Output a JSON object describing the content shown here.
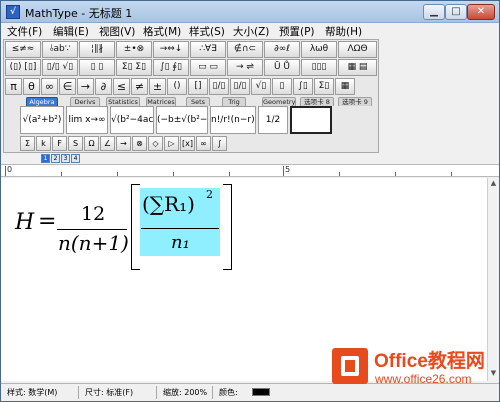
{
  "window": {
    "title": "MathType - 无标题 1"
  },
  "menu": [
    "文件(F)",
    "编辑(E)",
    "视图(V)",
    "格式(M)",
    "样式(S)",
    "大小(Z)",
    "预置(P)",
    "帮助(H)"
  ],
  "palette": {
    "row1": [
      "≤≠≈",
      "⫰ab∵",
      "¦∥∦",
      "±•⊗",
      "→⇔↓",
      "∴∀∃",
      "∉∩⊂",
      "∂∞ℓ",
      "λωθ",
      "ΛΩΘ"
    ],
    "row2": [
      "(▯) [▯]",
      "▯/▯ √▯",
      "▯ ▯",
      "Σ▯ Σ▯",
      "∫▯ ∮▯",
      "▭ ▭",
      "→ ⇌",
      "Ū Ů",
      "▯▯▯",
      "▦ ▤"
    ],
    "row3": [
      "π",
      "θ",
      "∞",
      "∈",
      "→",
      "∂",
      "≤",
      "≠",
      "±",
      "()",
      "[]",
      "▯/▯",
      "▯/▯",
      "√▯",
      "▯",
      "∫▯",
      "Σ▯",
      "▦"
    ],
    "tabs": [
      "Algebra",
      "Derivs",
      "Statistics",
      "Matrices",
      "Sets",
      "Trig",
      "Geometry",
      "选项卡 8",
      "选项卡 9"
    ],
    "templates": [
      "√(a²+b²)",
      "lim x→∞",
      "√(b²−4ac)",
      "(−b±√(b²−4ac))/2a",
      "n!/r!(n−r)!",
      "1/2",
      ""
    ],
    "row5": [
      "Σ",
      "k",
      "F",
      "S",
      "Ω",
      "∠",
      "→",
      "⊗",
      "◇",
      "▷",
      "[x]",
      "∞",
      "∫"
    ]
  },
  "size_indicators": [
    "1",
    "2",
    "3",
    "4"
  ],
  "ruler": {
    "marks": [
      "0",
      "5"
    ]
  },
  "equation": {
    "lhs": "H",
    "equals": "=",
    "numerator": "12",
    "denominator": "n(n+1)",
    "inner_numerator": "(∑R₁)",
    "inner_exponent": "2",
    "inner_denominator": "n₁"
  },
  "status": {
    "style": "样式: 数学(M)",
    "size": "尺寸: 标准(F)",
    "zoom": "缩放: 200%",
    "color_label": "颜色:",
    "color_value": "#000000"
  },
  "watermark": {
    "title": "Office教程网",
    "url": "www.office26.com"
  }
}
